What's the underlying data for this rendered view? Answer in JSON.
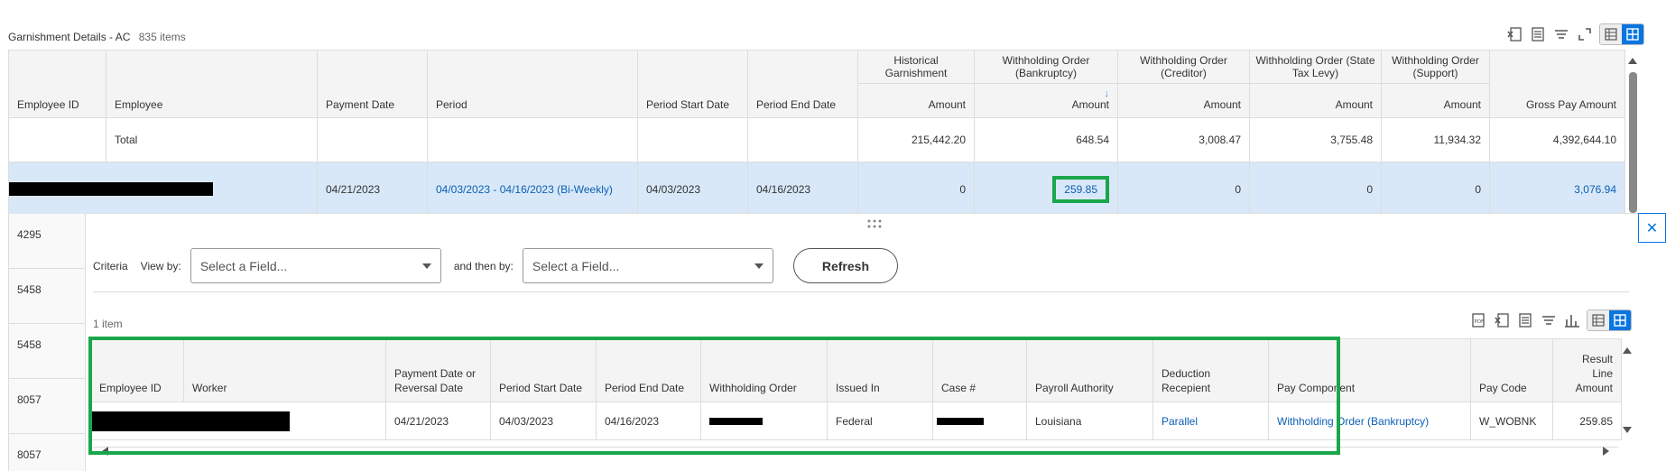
{
  "report": {
    "title": "Garnishment Details - AC",
    "count": "835 items"
  },
  "icons": {
    "export_excel": "excel-icon",
    "print": "print-icon",
    "filter": "filter-icon",
    "fullscreen": "fullscreen-icon",
    "table_view": "table-icon",
    "grid_view": "grid-icon",
    "pdf": "pdf-icon",
    "chart": "chart-icon",
    "close": "close-icon",
    "drag": "drag-handle-icon"
  },
  "main_table": {
    "groups": {
      "historical": "Historical Garnishment",
      "bankruptcy": "Withholding Order (Bankruptcy)",
      "creditor": "Withholding Order (Creditor)",
      "state_tax": "Withholding Order (State Tax Levy)",
      "support": "Withholding Order (Support)"
    },
    "columns": {
      "employee_id": "Employee ID",
      "employee": "Employee",
      "payment_date": "Payment Date",
      "period": "Period",
      "period_start": "Period Start Date",
      "period_end": "Period End Date",
      "amount": "Amount",
      "gross_pay": "Gross Pay Amount"
    },
    "total_row": {
      "label": "Total",
      "historical": "215,442.20",
      "bankruptcy": "648.54",
      "creditor": "3,008.47",
      "state_tax": "3,755.48",
      "support": "11,934.32",
      "gross_pay": "4,392,644.10"
    },
    "selected_row": {
      "payment_date": "04/21/2023",
      "period": "04/03/2023 - 04/16/2023 (Bi-Weekly)",
      "period_start": "04/03/2023",
      "period_end": "04/16/2023",
      "historical": "0",
      "bankruptcy": "259.85",
      "creditor": "0",
      "state_tax": "0",
      "support": "0",
      "gross_pay": "3,076.94"
    },
    "other_ids": [
      "4295",
      "5458",
      "5458",
      "8057",
      "8057"
    ]
  },
  "criteria": {
    "label": "Criteria",
    "view_by_label": "View by:",
    "view_by_value": "Select a Field...",
    "then_by_label": "and then by:",
    "then_by_value": "Select a Field...",
    "refresh_label": "Refresh"
  },
  "sub_table": {
    "item_count": "1 item",
    "columns": {
      "employee_id": "Employee ID",
      "worker": "Worker",
      "payment_date": "Payment Date or Reversal Date",
      "period_start": "Period Start Date",
      "period_end": "Period End Date",
      "withholding_order": "Withholding Order",
      "issued_in": "Issued In",
      "case_no": "Case #",
      "payroll_authority": "Payroll Authority",
      "deduction_recipient": "Deduction Recepient",
      "pay_component": "Pay Component",
      "pay_code": "Pay Code",
      "result_line_amount": "Result Line Amount"
    },
    "row": {
      "payment_date": "04/21/2023",
      "period_start": "04/03/2023",
      "period_end": "04/16/2023",
      "issued_in": "Federal",
      "payroll_authority": "Louisiana",
      "deduction_recipient": "Parallel",
      "pay_component": "Withholding Order (Bankruptcy)",
      "pay_code": "W_WOBNK",
      "result_line_amount": "259.85"
    }
  },
  "colors": {
    "accent": "#0875e1",
    "link": "#0b5fb4",
    "highlight": "#1aa64a",
    "selected_row": "#d8e8f8"
  }
}
